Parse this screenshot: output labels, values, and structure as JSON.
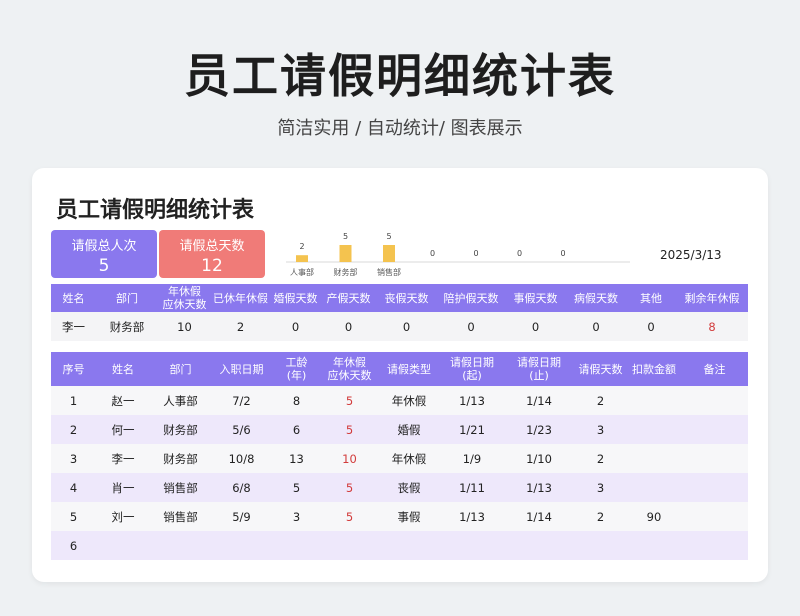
{
  "page": {
    "title": "员工请假明细统计表",
    "subtitle": "简洁实用 / 自动统计/ 图表展示"
  },
  "card": {
    "title": "员工请假明细统计表",
    "stats": {
      "total_people_label": "请假总人次",
      "total_people_value": "5",
      "total_days_label": "请假总天数",
      "total_days_value": "12"
    },
    "date": "2025/3/13"
  },
  "colors": {
    "accent_purple": "#8a78ee",
    "accent_red": "#f07b78",
    "bar_yellow": "#f4c34f",
    "highlight_red": "#d23c3c",
    "row_alt": "#eee8fb"
  },
  "chart_data": {
    "type": "bar",
    "categories": [
      "人事部",
      "财务部",
      "销售部",
      "",
      "",
      "",
      ""
    ],
    "values": [
      2,
      5,
      5,
      0,
      0,
      0,
      0
    ],
    "ylim": [
      0,
      5
    ],
    "grid": false,
    "legend": "none"
  },
  "summary_table": {
    "headers": [
      "姓名",
      "部门",
      "年休假\n应休天数",
      "已休年休假",
      "婚假天数",
      "产假天数",
      "丧假天数",
      "陪护假天数",
      "事假天数",
      "病假天数",
      "其他",
      "剩余年休假"
    ],
    "row": [
      "李一",
      "财务部",
      "10",
      "2",
      "0",
      "0",
      "0",
      "0",
      "0",
      "0",
      "0",
      "8"
    ]
  },
  "detail_table": {
    "headers": [
      "序号",
      "姓名",
      "部门",
      "入职日期",
      "工龄\n(年)",
      "年休假\n应休天数",
      "请假类型",
      "请假日期\n(起)",
      "请假日期\n(止)",
      "请假天数",
      "扣款金额",
      "备注"
    ],
    "rows": [
      [
        "1",
        "赵一",
        "人事部",
        "7/2",
        "8",
        "5",
        "年休假",
        "1/13",
        "1/14",
        "2",
        "",
        ""
      ],
      [
        "2",
        "何一",
        "财务部",
        "5/6",
        "6",
        "5",
        "婚假",
        "1/21",
        "1/23",
        "3",
        "",
        ""
      ],
      [
        "3",
        "李一",
        "财务部",
        "10/8",
        "13",
        "10",
        "年休假",
        "1/9",
        "1/10",
        "2",
        "",
        ""
      ],
      [
        "4",
        "肖一",
        "销售部",
        "6/8",
        "5",
        "5",
        "丧假",
        "1/11",
        "1/13",
        "3",
        "",
        ""
      ],
      [
        "5",
        "刘一",
        "销售部",
        "5/9",
        "3",
        "5",
        "事假",
        "1/13",
        "1/14",
        "2",
        "90",
        ""
      ],
      [
        "6",
        "",
        "",
        "",
        "",
        "",
        "",
        "",
        "",
        "",
        "",
        ""
      ]
    ]
  }
}
